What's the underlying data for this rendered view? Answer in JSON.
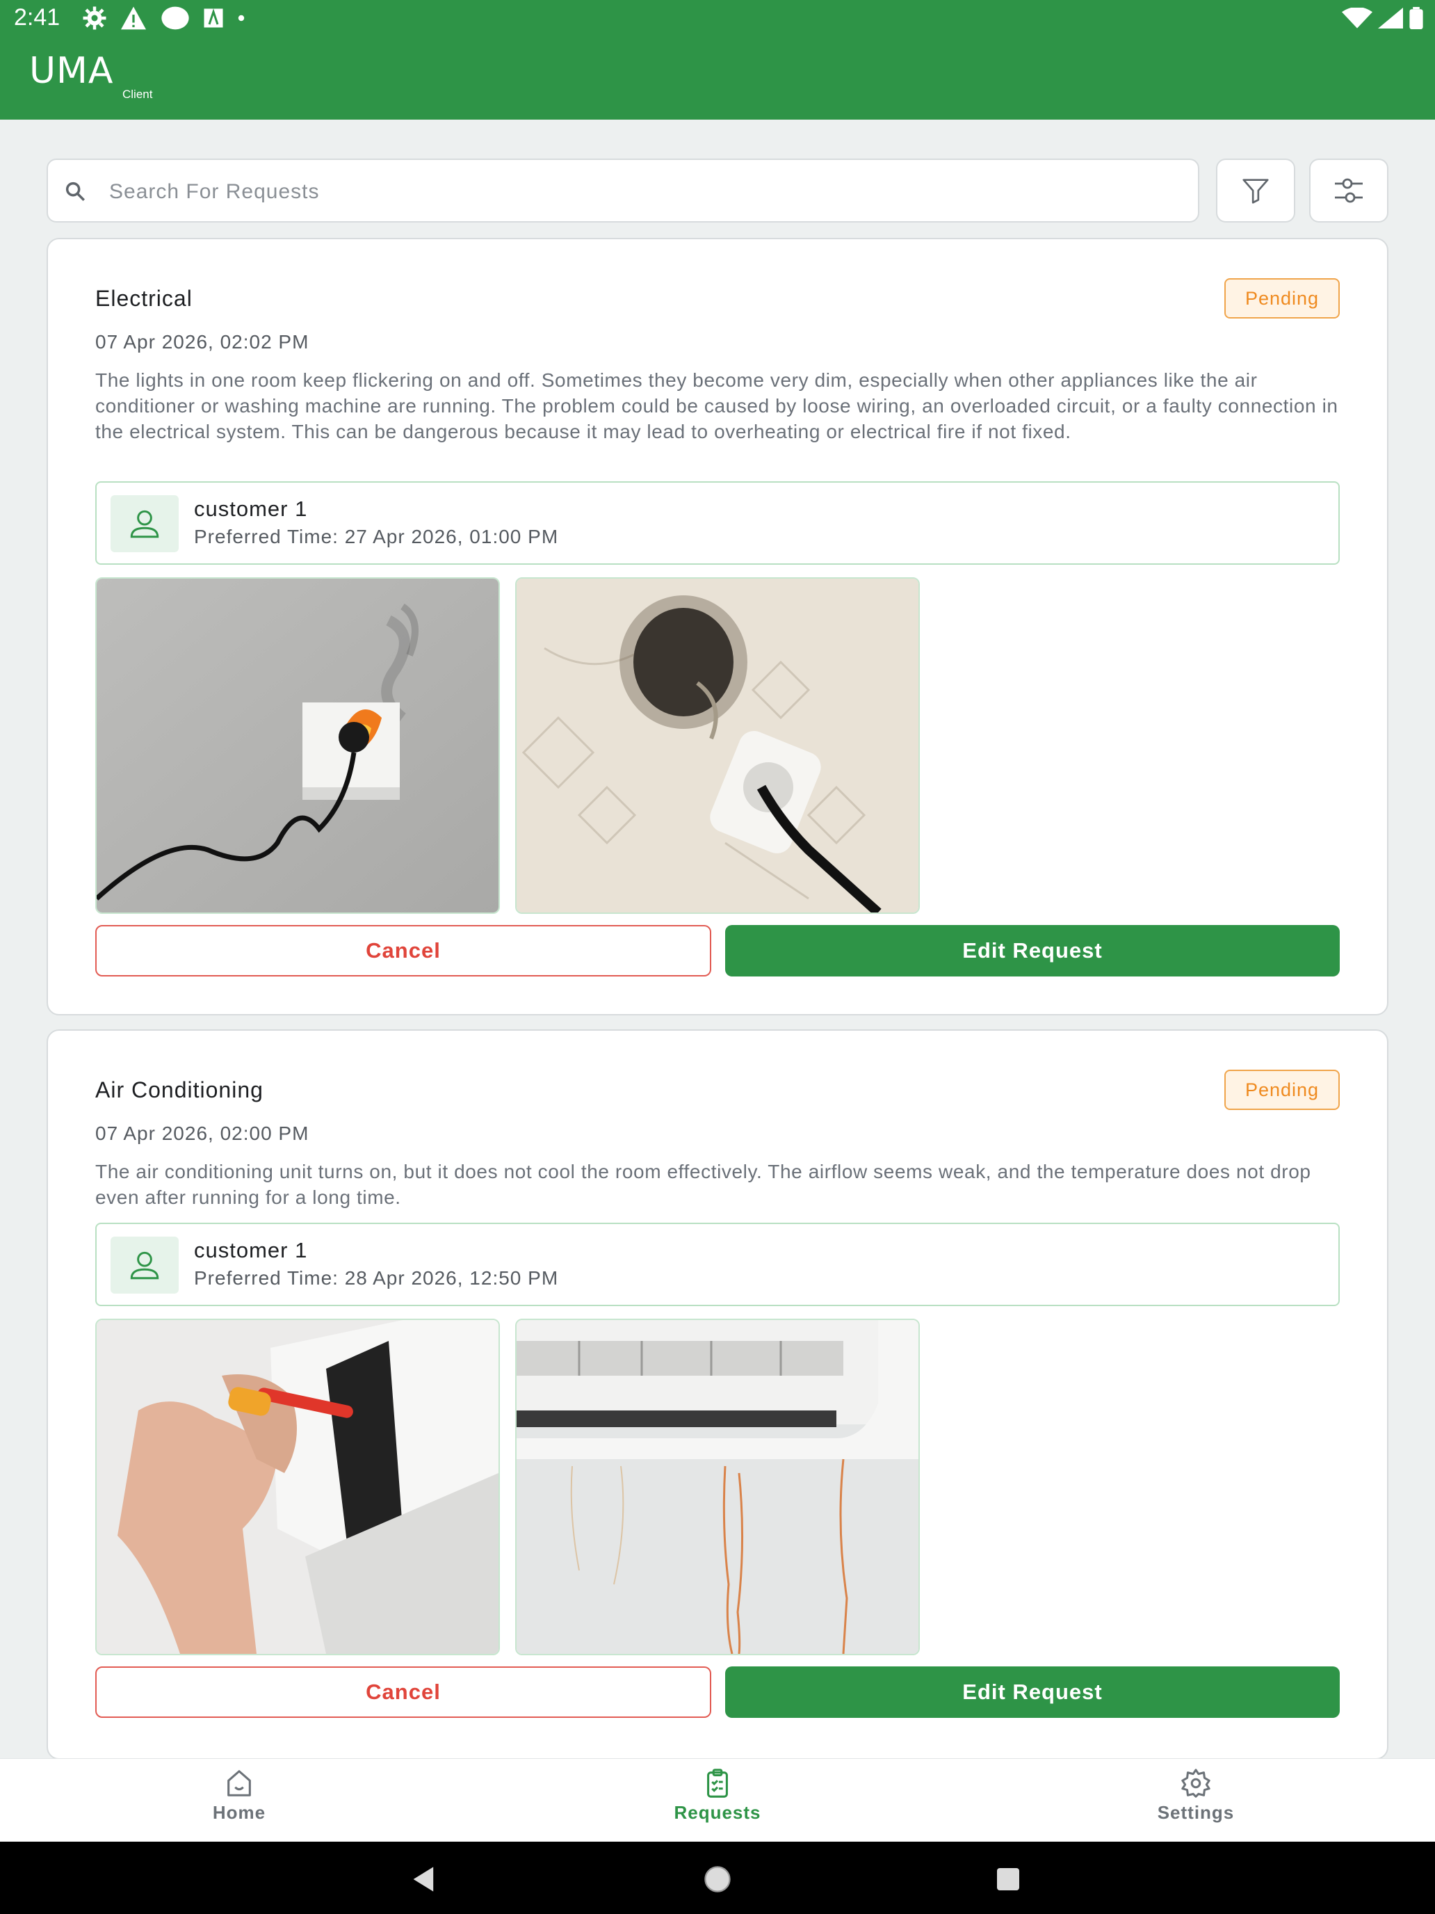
{
  "status_bar": {
    "time": "2:41",
    "left_icons": [
      "gear-icon",
      "warning-icon",
      "circle-icon",
      "a-box-icon",
      "dot-icon"
    ],
    "right_icons": [
      "wifi-icon",
      "signal-icon",
      "battery-icon"
    ]
  },
  "header": {
    "logo": "UMA",
    "logo_sub": "Client"
  },
  "search": {
    "placeholder": "Search For Requests",
    "value": ""
  },
  "toolbar": {
    "filter_icon": "filter-icon",
    "adjust_icon": "sliders-icon"
  },
  "requests": [
    {
      "title": "Electrical",
      "status": "Pending",
      "date": "07 Apr 2026, 02:02 PM",
      "description": "The lights in one room keep flickering on and off. Sometimes they become very dim, especially when other appliances like the air conditioner or washing machine are running. The problem could be caused by loose wiring, an overloaded circuit, or a faulty connection in the electrical system. This can be dangerous because it may lead to overheating or electrical fire if not fixed.",
      "customer": "customer 1",
      "preferred_time": "Preferred Time: 27 Apr 2026, 01:00 PM",
      "cancel_label": "Cancel",
      "edit_label": "Edit Request"
    },
    {
      "title": "Air Conditioning",
      "status": "Pending",
      "date": "07 Apr 2026, 02:00 PM",
      "description": "The air conditioning unit turns on, but it does not cool the room effectively. The airflow seems weak, and the temperature does not drop even after running for a long time.",
      "customer": "customer 1",
      "preferred_time": "Preferred Time: 28 Apr 2026, 12:50 PM",
      "cancel_label": "Cancel",
      "edit_label": "Edit Request"
    }
  ],
  "nav": [
    {
      "label": "Home",
      "icon": "home-icon",
      "active": false
    },
    {
      "label": "Requests",
      "icon": "clipboard-icon",
      "active": true
    },
    {
      "label": "Settings",
      "icon": "gear-icon",
      "active": false
    }
  ],
  "colors": {
    "brand": "#2e9447",
    "pending": "#ef8a1f",
    "cancel": "#e0443a"
  }
}
